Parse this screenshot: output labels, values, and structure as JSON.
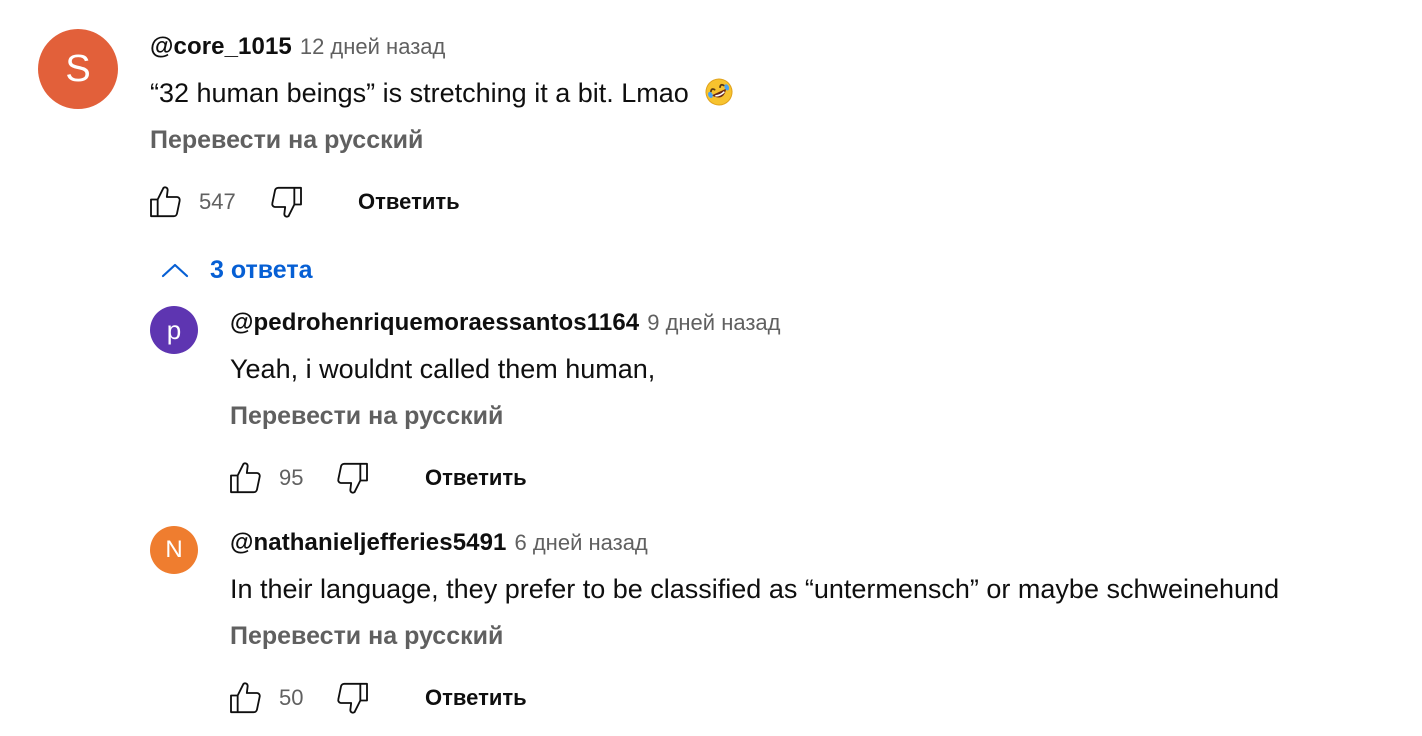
{
  "comments": [
    {
      "avatar_letter": "S",
      "avatar_color": "#e2603a",
      "author": "@core_1015",
      "time": "12 дней назад",
      "text": "“32 human beings” is stretching it a bit. Lmao",
      "emoji": "rolling-on-floor-laughing-emoji",
      "translate_label": "Перевести на русский",
      "likes": "547",
      "reply_label": "Ответить"
    }
  ],
  "replies_toggle": {
    "label": "3 ответа",
    "icon": "chevron-up-icon",
    "color": "#065fd4"
  },
  "replies": [
    {
      "avatar_letter": "p",
      "avatar_color": "#5e35b1",
      "author": "@pedrohenriquemoraessantos1164",
      "time": "9 дней назад",
      "text": "Yeah, i wouldnt called them human,",
      "translate_label": "Перевести на русский",
      "likes": "95",
      "reply_label": "Ответить"
    },
    {
      "avatar_letter": "N",
      "avatar_color": "#ef7d2f",
      "author": "@nathanieljefferies5491",
      "time": "6 дней назад",
      "text": "In their language, they prefer to be classified as “untermensch” or maybe schweinehund",
      "translate_label": "Перевести на русский",
      "likes": "50",
      "reply_label": "Ответить"
    }
  ]
}
